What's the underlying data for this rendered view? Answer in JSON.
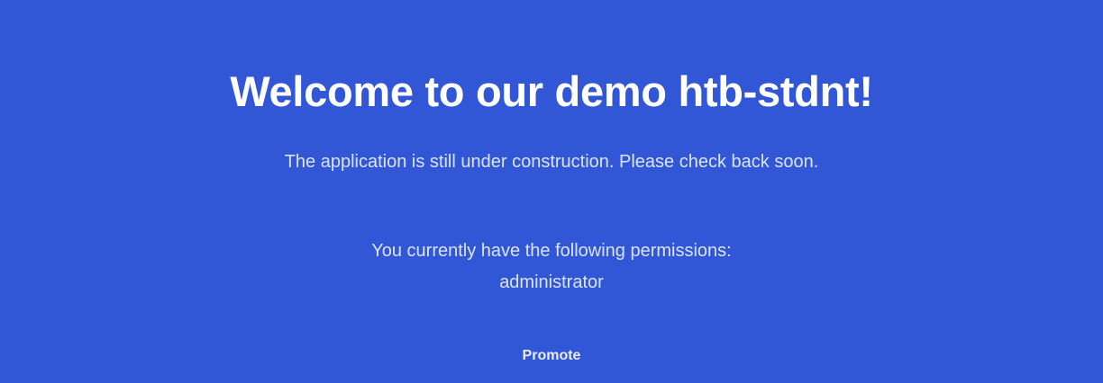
{
  "page": {
    "title": "Welcome to our demo htb-stdnt!",
    "message": "The application is still under construction. Please check back soon.",
    "permissions_label": "You currently have the following permissions:",
    "permissions_value": "administrator",
    "promote_label": "Promote"
  },
  "colors": {
    "background": "#3257d6",
    "title": "#ffffff",
    "body_text": "#dbe4ff"
  }
}
